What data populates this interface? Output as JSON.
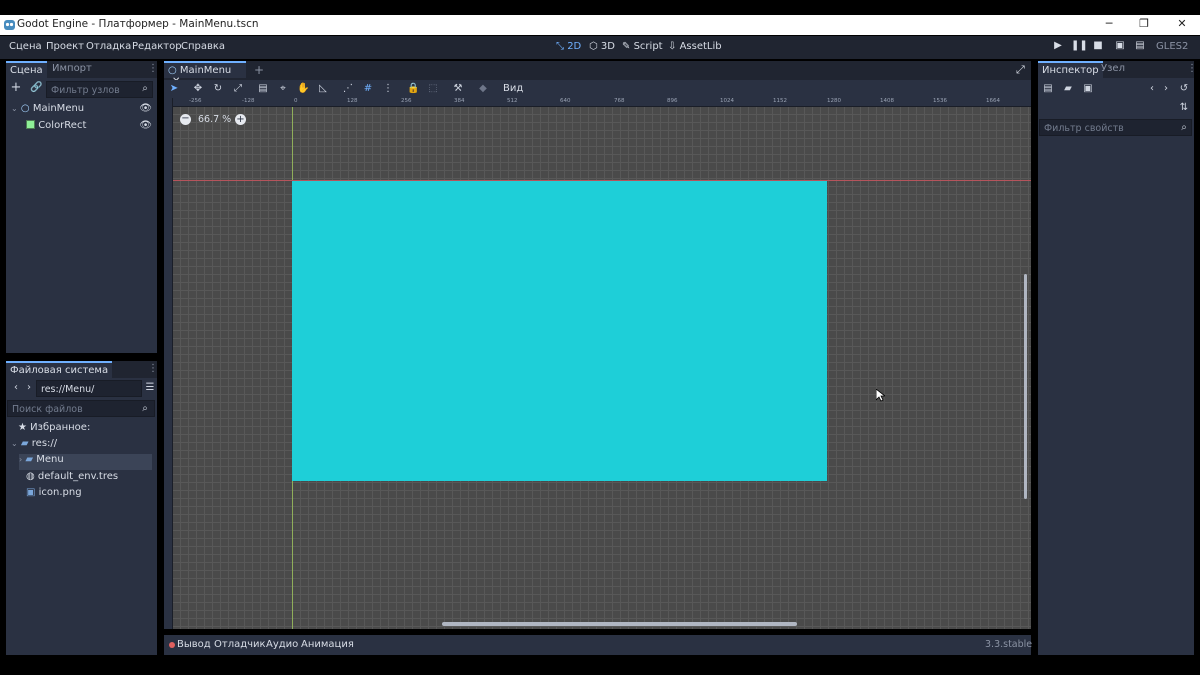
{
  "window": {
    "title": "Godot Engine - Платформер - MainMenu.tscn",
    "buttons": [
      "─",
      "❐",
      "✕"
    ]
  },
  "menubar": {
    "items": [
      "Сцена",
      "Проект",
      "Отладка",
      "Редактор",
      "Справка"
    ],
    "workspaces": [
      {
        "label": "2D",
        "icon": "2d-icon",
        "active": true
      },
      {
        "label": "3D",
        "icon": "3d-icon",
        "active": false
      },
      {
        "label": "Script",
        "icon": "script-icon",
        "active": false
      },
      {
        "label": "AssetLib",
        "icon": "assetlib-icon",
        "active": false
      }
    ],
    "renderer": "GLES2"
  },
  "scene_dock": {
    "tabs": [
      "Сцена",
      "Импорт"
    ],
    "filter_placeholder": "Фильтр узлов",
    "nodes": [
      {
        "name": "MainMenu",
        "type": "Control"
      },
      {
        "name": "ColorRect",
        "type": "ColorRect"
      }
    ]
  },
  "filesystem_dock": {
    "tab": "Файловая система",
    "path": "res://Menu/",
    "search_placeholder": "Поиск файлов",
    "favorites_label": "Избранное:",
    "items": [
      {
        "label": "res://",
        "kind": "folder"
      },
      {
        "label": "Menu",
        "kind": "folder",
        "selected": true
      },
      {
        "label": "default_env.tres",
        "kind": "resource"
      },
      {
        "label": "icon.png",
        "kind": "image"
      }
    ]
  },
  "editor": {
    "scene_tab": "MainMenu",
    "view_menu": "Вид",
    "zoom": "66.7 %",
    "ruler_top": [
      "-256",
      "-128",
      "0",
      "128",
      "256",
      "384",
      "512",
      "640",
      "768",
      "896",
      "1024",
      "1152",
      "1280",
      "1408",
      "1536",
      "1664"
    ],
    "color_rect_color": "#1ecfd8"
  },
  "bottom_panel": {
    "tabs": [
      "Вывод",
      "Отладчик",
      "Аудио",
      "Анимация"
    ],
    "version": "3.3.stable"
  },
  "inspector": {
    "tabs": [
      "Инспектор",
      "Узел"
    ],
    "filter_placeholder": "Фильтр свойств"
  },
  "colors": {
    "accent": "#6fb0ff",
    "panel": "#2a3142",
    "panel_dark": "#202531",
    "viewport": "#4a4a4a"
  }
}
